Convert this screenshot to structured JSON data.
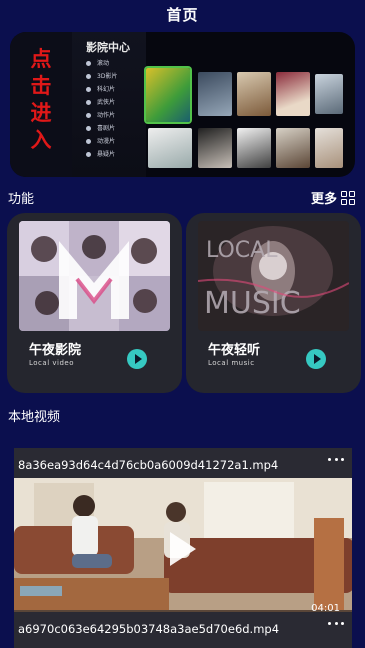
{
  "header": {
    "title": "首页"
  },
  "banner": {
    "vertical_text": [
      "点",
      "击",
      "进",
      "入"
    ],
    "menu_title": "影院中心",
    "menu_items": [
      "滚动",
      "3D影片",
      "科幻片",
      "武侠片",
      "动作片",
      "喜剧片",
      "动漫片",
      "悬疑片"
    ]
  },
  "features": {
    "label": "功能",
    "more_label": "更多",
    "cards": [
      {
        "title": "午夜影院",
        "subtitle": "Local video"
      },
      {
        "title": "午夜轻听",
        "subtitle": "Local music"
      }
    ]
  },
  "local_videos": {
    "label": "本地视频",
    "items": [
      {
        "filename": "8a36ea93d64c4d76cb0a6009d41272a1.mp4",
        "duration": "04:01"
      },
      {
        "filename": "a6970c063e64295b03748a3ae5d70e6d.mp4"
      }
    ]
  },
  "icons": {
    "more": "grid-icon",
    "card_play": "play-icon",
    "video_play": "play-icon",
    "video_menu": "more-dots-icon"
  },
  "colors": {
    "background": "#0b0f4e",
    "card": "#25262e",
    "accent": "#36c9c2",
    "banner_text": "#e01818"
  }
}
